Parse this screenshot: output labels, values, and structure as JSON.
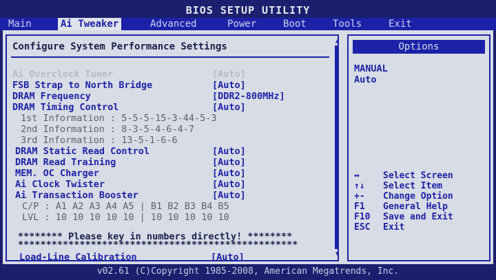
{
  "title": "BIOS SETUP UTILITY",
  "menu": [
    "Main",
    "Ai Tweaker",
    "Advanced",
    "Power",
    "Boot",
    "Tools",
    "Exit"
  ],
  "section_title": "Configure System Performance Settings",
  "settings": [
    {
      "label": "Ai Overclock Tuner",
      "value": "[Auto]"
    },
    {
      "label": "FSB Strap to North Bridge",
      "value": "[Auto]"
    },
    {
      "label": "DRAM Frequency",
      "value": "[DDR2-800MHz]"
    },
    {
      "label": "DRAM Timing Control",
      "value": "[Auto]"
    },
    {
      "label": "1st Information : 5-5-5-15-3-44-5-3",
      "value": ""
    },
    {
      "label": "2nd Information : 8-3-5-4-6-4-7",
      "value": ""
    },
    {
      "label": "3rd Information : 13-5-1-6-6",
      "value": ""
    },
    {
      "label": "DRAM Static Read Control",
      "value": "[Auto]"
    },
    {
      "label": "DRAM Read Training",
      "value": "[Auto]"
    },
    {
      "label": "MEM. OC Charger",
      "value": "[Auto]"
    },
    {
      "label": "Ai Clock Twister",
      "value": "[Auto]"
    },
    {
      "label": "Ai Transaction Booster",
      "value": "[Auto]"
    },
    {
      "label": "C/P : A1 A2 A3 A4 A5 | B1 B2 B3 B4 B5",
      "value": ""
    },
    {
      "label": "LVL : 10 10 10 10 10 | 10 10 10 10 10",
      "value": ""
    },
    {
      "label": "******** Please key in numbers directly! ********",
      "value": ""
    },
    {
      "label": "**************************************************",
      "value": ""
    },
    {
      "label": "Load-Line Calibration",
      "value": "[Auto]"
    }
  ],
  "options_header": "Options",
  "options": [
    "MANUAL",
    "Auto"
  ],
  "help": [
    {
      "key": "↔",
      "desc": "Select Screen"
    },
    {
      "key": "↑↓",
      "desc": "Select Item"
    },
    {
      "key": "+-",
      "desc": "Change Option"
    },
    {
      "key": "F1",
      "desc": "General Help"
    },
    {
      "key": "F10",
      "desc": "Save and Exit"
    },
    {
      "key": "ESC",
      "desc": "Exit"
    }
  ],
  "footer": "v02.61 (C)Copyright 1985-2008, American Megatrends, Inc."
}
